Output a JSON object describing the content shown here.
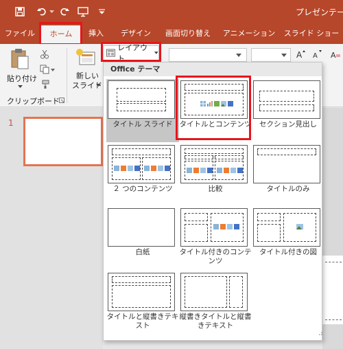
{
  "titlebar": {
    "doc_title": "プレゼンテー",
    "save_icon": "save-icon",
    "undo_icon": "undo-icon",
    "redo_icon": "redo-icon",
    "present_icon": "present-from-start-icon",
    "customize_icon": "customize-qat-icon"
  },
  "tabs": [
    {
      "label": "ファイル"
    },
    {
      "label": "ホーム",
      "active": true
    },
    {
      "label": "挿入"
    },
    {
      "label": "デザイン"
    },
    {
      "label": "画面切り替え"
    },
    {
      "label": "アニメーション"
    },
    {
      "label": "スライド ショー"
    }
  ],
  "ribbon": {
    "paste_label": "貼り付け",
    "clipboard_group": "クリップボード",
    "new_slide_line1": "新しい",
    "new_slide_line2": "スライド",
    "layout_label": "レイアウト"
  },
  "slides_pane": {
    "slide_number": "1"
  },
  "layout_gallery": {
    "header": "Office テーマ",
    "items": [
      {
        "label": "タイトル スライド",
        "selected": true
      },
      {
        "label": "タイトルとコンテンツ",
        "highlighted": true
      },
      {
        "label": "セクション見出し"
      },
      {
        "label": "２ つのコンテンツ"
      },
      {
        "label": "比較"
      },
      {
        "label": "タイトルのみ"
      },
      {
        "label": "白紙"
      },
      {
        "label": "タイトル付きのコンテンツ"
      },
      {
        "label": "タイトル付きの図"
      },
      {
        "label": "タイトルと縦書きテキスト"
      },
      {
        "label": "縦書きタイトルと縦書きテキスト"
      }
    ]
  },
  "colors": {
    "accent": "#b7472a",
    "annotation_red": "#e8141b",
    "thumb_border": "#e5734f"
  }
}
